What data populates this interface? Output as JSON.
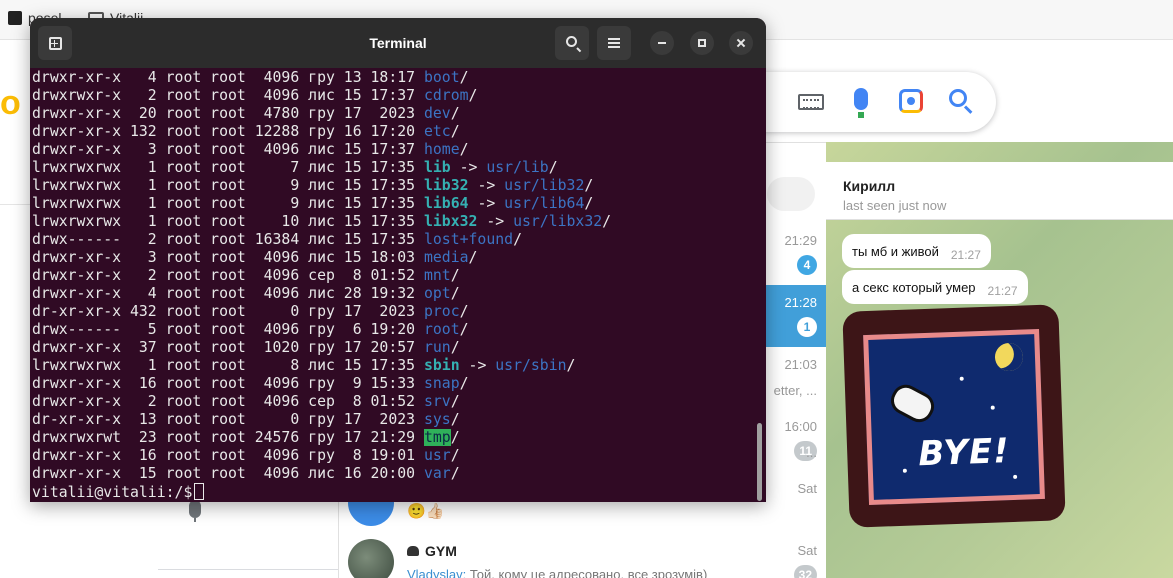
{
  "browser": {
    "tabs": [
      {
        "label": "posel"
      },
      {
        "label": "Vitalii"
      }
    ]
  },
  "terminal": {
    "title": "Terminal",
    "listing": [
      {
        "perms": "drwxr-xr-x",
        "links": "4",
        "owner": "root",
        "group": "root",
        "size": "4096",
        "month": "гру",
        "day": "13",
        "time": "18:17",
        "name": "boot",
        "kind": "dir",
        "target": ""
      },
      {
        "perms": "drwxrwxr-x",
        "links": "2",
        "owner": "root",
        "group": "root",
        "size": "4096",
        "month": "лис",
        "day": "15",
        "time": "17:37",
        "name": "cdrom",
        "kind": "dir",
        "target": ""
      },
      {
        "perms": "drwxr-xr-x",
        "links": "20",
        "owner": "root",
        "group": "root",
        "size": "4780",
        "month": "гру",
        "day": "17",
        "time": "2023",
        "name": "dev",
        "kind": "dir",
        "target": ""
      },
      {
        "perms": "drwxr-xr-x",
        "links": "132",
        "owner": "root",
        "group": "root",
        "size": "12288",
        "month": "гру",
        "day": "16",
        "time": "17:20",
        "name": "etc",
        "kind": "dir",
        "target": ""
      },
      {
        "perms": "drwxr-xr-x",
        "links": "3",
        "owner": "root",
        "group": "root",
        "size": "4096",
        "month": "лис",
        "day": "15",
        "time": "17:37",
        "name": "home",
        "kind": "dir",
        "target": ""
      },
      {
        "perms": "lrwxrwxrwx",
        "links": "1",
        "owner": "root",
        "group": "root",
        "size": "7",
        "month": "лис",
        "day": "15",
        "time": "17:35",
        "name": "lib",
        "kind": "link",
        "target": "usr/lib"
      },
      {
        "perms": "lrwxrwxrwx",
        "links": "1",
        "owner": "root",
        "group": "root",
        "size": "9",
        "month": "лис",
        "day": "15",
        "time": "17:35",
        "name": "lib32",
        "kind": "link",
        "target": "usr/lib32"
      },
      {
        "perms": "lrwxrwxrwx",
        "links": "1",
        "owner": "root",
        "group": "root",
        "size": "9",
        "month": "лис",
        "day": "15",
        "time": "17:35",
        "name": "lib64",
        "kind": "link",
        "target": "usr/lib64"
      },
      {
        "perms": "lrwxrwxrwx",
        "links": "1",
        "owner": "root",
        "group": "root",
        "size": "10",
        "month": "лис",
        "day": "15",
        "time": "17:35",
        "name": "libx32",
        "kind": "link",
        "target": "usr/libx32"
      },
      {
        "perms": "drwx------",
        "links": "2",
        "owner": "root",
        "group": "root",
        "size": "16384",
        "month": "лис",
        "day": "15",
        "time": "17:35",
        "name": "lost+found",
        "kind": "dir",
        "target": ""
      },
      {
        "perms": "drwxr-xr-x",
        "links": "3",
        "owner": "root",
        "group": "root",
        "size": "4096",
        "month": "лис",
        "day": "15",
        "time": "18:03",
        "name": "media",
        "kind": "dir",
        "target": ""
      },
      {
        "perms": "drwxr-xr-x",
        "links": "2",
        "owner": "root",
        "group": "root",
        "size": "4096",
        "month": "сер",
        "day": "8",
        "time": "01:52",
        "name": "mnt",
        "kind": "dir",
        "target": ""
      },
      {
        "perms": "drwxr-xr-x",
        "links": "4",
        "owner": "root",
        "group": "root",
        "size": "4096",
        "month": "лис",
        "day": "28",
        "time": "19:32",
        "name": "opt",
        "kind": "dir",
        "target": ""
      },
      {
        "perms": "dr-xr-xr-x",
        "links": "432",
        "owner": "root",
        "group": "root",
        "size": "0",
        "month": "гру",
        "day": "17",
        "time": "2023",
        "name": "proc",
        "kind": "dir",
        "target": ""
      },
      {
        "perms": "drwx------",
        "links": "5",
        "owner": "root",
        "group": "root",
        "size": "4096",
        "month": "гру",
        "day": "6",
        "time": "19:20",
        "name": "root",
        "kind": "dir",
        "target": ""
      },
      {
        "perms": "drwxr-xr-x",
        "links": "37",
        "owner": "root",
        "group": "root",
        "size": "1020",
        "month": "гру",
        "day": "17",
        "time": "20:57",
        "name": "run",
        "kind": "dir",
        "target": ""
      },
      {
        "perms": "lrwxrwxrwx",
        "links": "1",
        "owner": "root",
        "group": "root",
        "size": "8",
        "month": "лис",
        "day": "15",
        "time": "17:35",
        "name": "sbin",
        "kind": "link",
        "target": "usr/sbin"
      },
      {
        "perms": "drwxr-xr-x",
        "links": "16",
        "owner": "root",
        "group": "root",
        "size": "4096",
        "month": "гру",
        "day": "9",
        "time": "15:33",
        "name": "snap",
        "kind": "dir",
        "target": ""
      },
      {
        "perms": "drwxr-xr-x",
        "links": "2",
        "owner": "root",
        "group": "root",
        "size": "4096",
        "month": "сер",
        "day": "8",
        "time": "01:52",
        "name": "srv",
        "kind": "dir",
        "target": ""
      },
      {
        "perms": "dr-xr-xr-x",
        "links": "13",
        "owner": "root",
        "group": "root",
        "size": "0",
        "month": "гру",
        "day": "17",
        "time": "2023",
        "name": "sys",
        "kind": "dir",
        "target": ""
      },
      {
        "perms": "drwxrwxrwt",
        "links": "23",
        "owner": "root",
        "group": "root",
        "size": "24576",
        "month": "гру",
        "day": "17",
        "time": "21:29",
        "name": "tmp",
        "kind": "sticky",
        "target": ""
      },
      {
        "perms": "drwxr-xr-x",
        "links": "16",
        "owner": "root",
        "group": "root",
        "size": "4096",
        "month": "гру",
        "day": "8",
        "time": "19:01",
        "name": "usr",
        "kind": "dir",
        "target": ""
      },
      {
        "perms": "drwxr-xr-x",
        "links": "15",
        "owner": "root",
        "group": "root",
        "size": "4096",
        "month": "лис",
        "day": "16",
        "time": "20:00",
        "name": "var",
        "kind": "dir",
        "target": ""
      }
    ],
    "prompt": "vitalii@vitalii:/$"
  },
  "telegram": {
    "chat_list": [
      {
        "time": "21:29",
        "badge": "4",
        "active": false,
        "preview": ""
      },
      {
        "time": "21:28",
        "badge": "1",
        "active": true,
        "preview": ""
      },
      {
        "time": "21:03",
        "badge": "",
        "active": false,
        "preview": "etter, ..."
      },
      {
        "time": "16:00",
        "badge": "11",
        "active": false,
        "preview": "..."
      },
      {
        "time": "Sat",
        "badge": "",
        "active": false,
        "preview": ""
      },
      {
        "time": "Sat",
        "badge": "32",
        "active": false,
        "preview": ""
      }
    ],
    "emoji_preview": "🙂👍🏻",
    "gym": {
      "name": "GYM",
      "sender": "Vladyslav:",
      "text": "Той, кому це адресовано, все зрозумів)"
    },
    "chat": {
      "name": "Кирилл",
      "status": "last seen just now",
      "messages": [
        {
          "text": "ты мб и живой",
          "time": "21:27"
        },
        {
          "text": "а секс который умер",
          "time": "21:27"
        }
      ],
      "sticker_text": "BYE!"
    }
  },
  "colors": {
    "terminal_bg": "#300a24",
    "dir": "#3c74c4",
    "link": "#35b0b2",
    "sticky_bg": "#2fb15a",
    "telegram_active": "#419fd9"
  }
}
